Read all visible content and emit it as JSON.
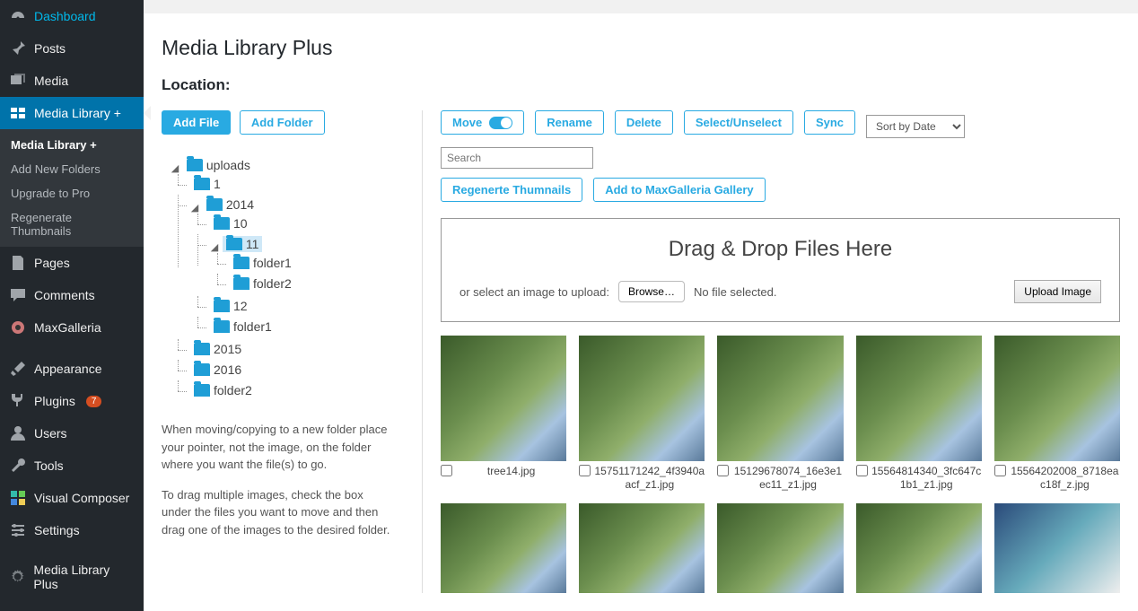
{
  "sidebar": {
    "items": [
      {
        "label": "Dashboard",
        "icon": "dash"
      },
      {
        "label": "Posts",
        "icon": "pin"
      },
      {
        "label": "Media",
        "icon": "media"
      },
      {
        "label": "Media Library +",
        "icon": "gallery",
        "active": true,
        "sub": [
          {
            "label": "Media Library +",
            "current": true
          },
          {
            "label": "Add New Folders"
          },
          {
            "label": "Upgrade to Pro"
          },
          {
            "label": "Regenerate Thumbnails"
          }
        ]
      },
      {
        "label": "Pages",
        "icon": "page"
      },
      {
        "label": "Comments",
        "icon": "comment"
      },
      {
        "label": "MaxGalleria",
        "icon": "maxg"
      },
      {
        "label": "Appearance",
        "icon": "brush"
      },
      {
        "label": "Plugins",
        "icon": "plug",
        "badge": "7"
      },
      {
        "label": "Users",
        "icon": "user"
      },
      {
        "label": "Tools",
        "icon": "wrench"
      },
      {
        "label": "Visual Composer",
        "icon": "vc"
      },
      {
        "label": "Settings",
        "icon": "sliders"
      },
      {
        "label": "Media Library Plus",
        "icon": "gear"
      }
    ]
  },
  "page": {
    "title": "Media Library Plus",
    "subtitle": "Location:"
  },
  "left_buttons": {
    "add_file": "Add File",
    "add_folder": "Add Folder"
  },
  "tree": {
    "root": "uploads",
    "n1": "1",
    "n2014": "2014",
    "n10": "10",
    "n11": "11",
    "folder1": "folder1",
    "folder2": "folder2",
    "n12": "12",
    "folder1b": "folder1",
    "n2015": "2015",
    "n2016": "2016",
    "folder2b": "folder2"
  },
  "help": {
    "p1": "When moving/copying to a new folder place your pointer, not the image, on the folder where you want the file(s) to go.",
    "p2": "To drag multiple images, check the box under the files you want to move and then drag one of the images to the desired folder."
  },
  "toolbar": {
    "move": "Move",
    "rename": "Rename",
    "delete": "Delete",
    "select": "Select/Unselect",
    "sync": "Sync",
    "sort": "Sort by Date",
    "search_placeholder": "Search",
    "regen": "Regenerte Thumnails",
    "addgal": "Add to MaxGalleria Gallery"
  },
  "dropzone": {
    "title": "Drag & Drop Files Here",
    "prompt": "or select an image to upload:",
    "browse": "Browse…",
    "nofile": "No file selected.",
    "upload": "Upload Image"
  },
  "files": [
    {
      "name": "tree14.jpg"
    },
    {
      "name": "15751171242_4f3940aacf_z1.jpg"
    },
    {
      "name": "15129678074_16e3e1ec11_z1.jpg"
    },
    {
      "name": "15564814340_3fc647c1b1_z1.jpg"
    },
    {
      "name": "15564202008_8718eac18f_z.jpg"
    }
  ]
}
